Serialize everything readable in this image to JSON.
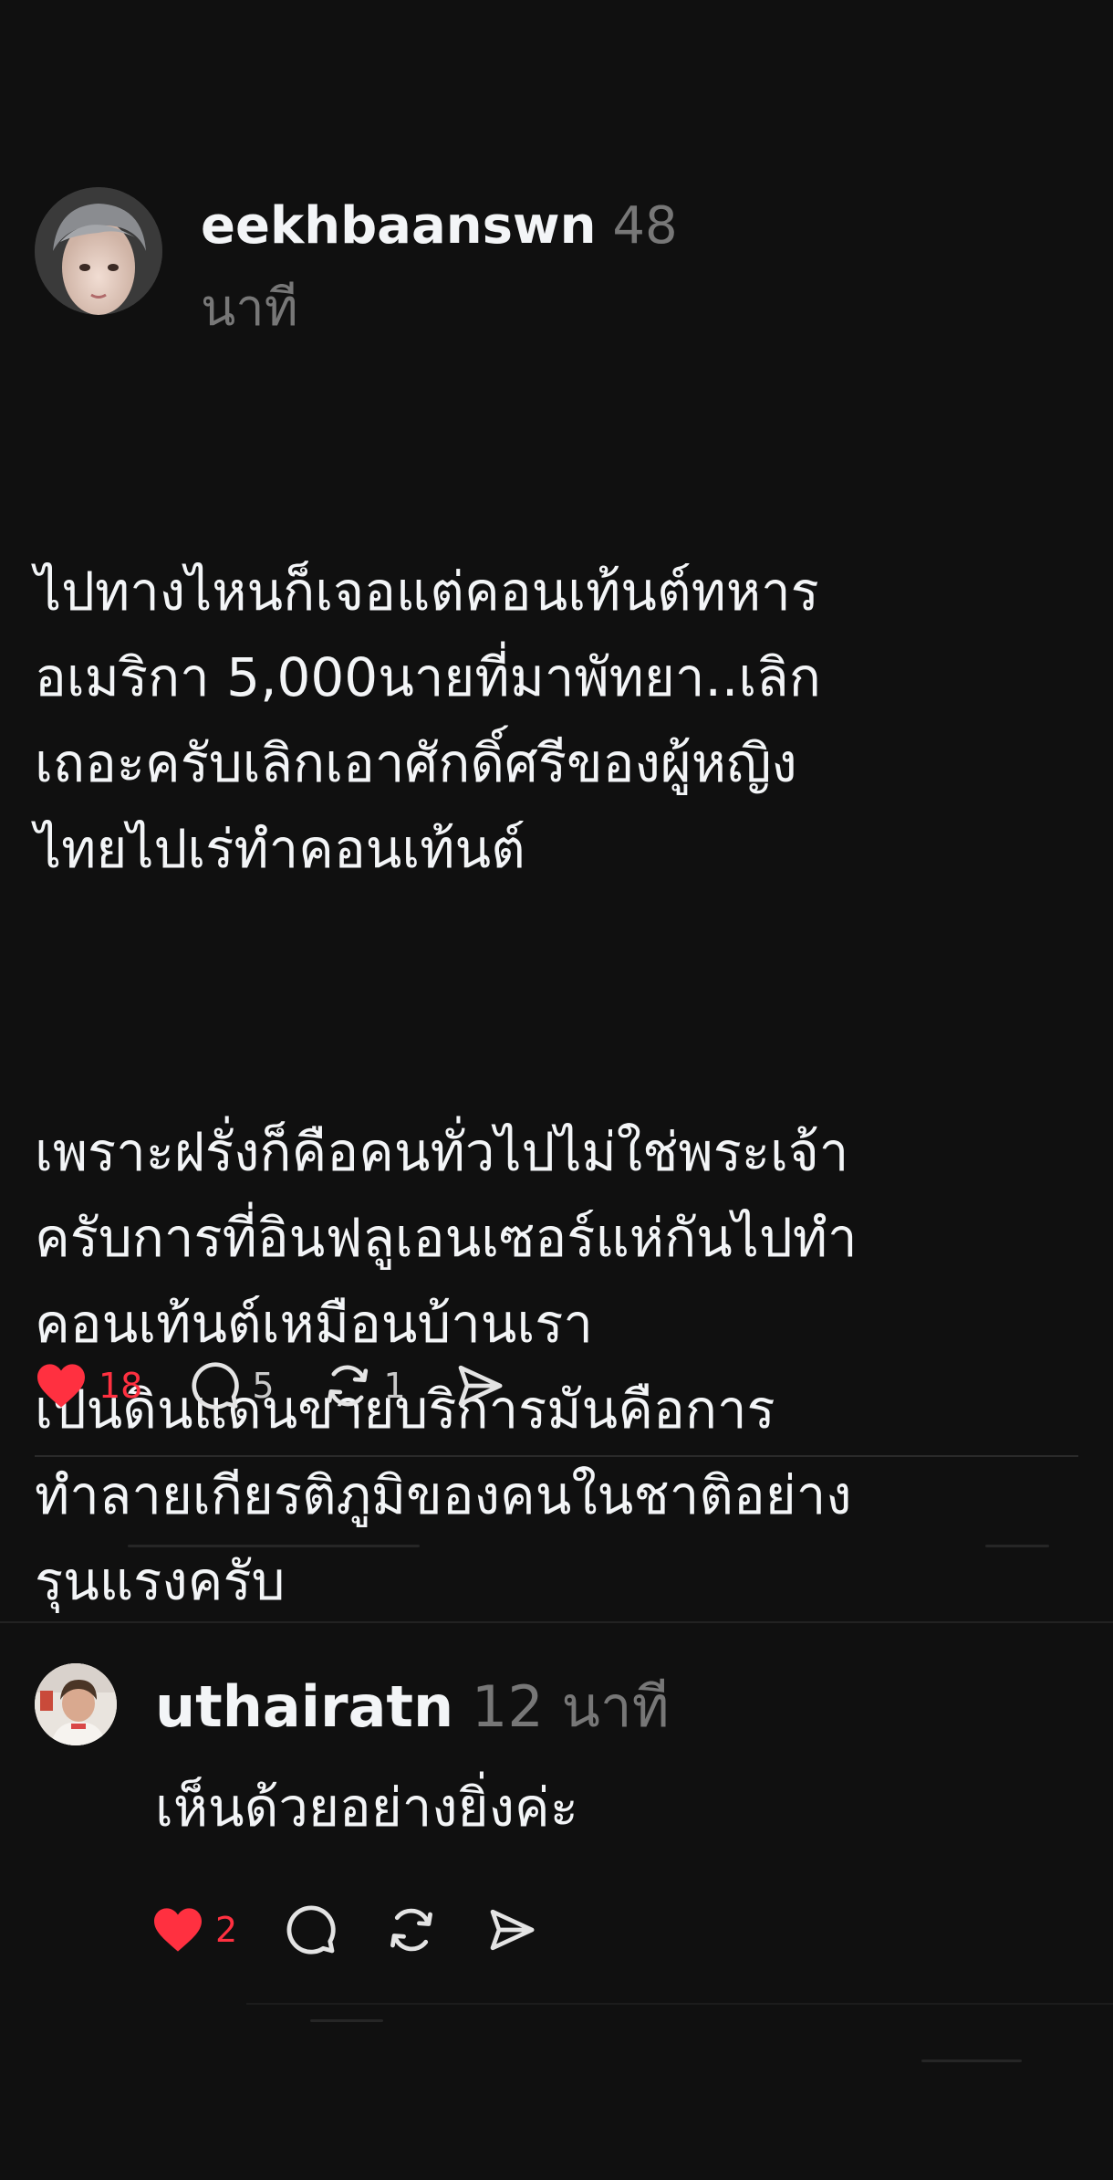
{
  "post": {
    "username": "eekhbaanswn",
    "time": "48 นาที",
    "paragraphs": [
      "ไปทางไหนก็เจอแต่คอนเท้นต์ทหาร\nอเมริกา 5,000นายที่มาพัทยา..เลิก\nเถอะครับเลิกเอาศักดิ์ศรีของผู้หญิง\nไทยไปเร่ทำคอนเท้นต์",
      "เพราะฝรั่งก็คือคนทั่วไปไม่ใช่พระเจ้า\nครับการที่อินฟลูเอนเซอร์แห่กันไปทำ\nคอนเท้นต์เหมือนบ้านเรา\nเป็นดินแดนขายบริการมันคือการ\nทำลายเกียรติภูมิของคนในชาติอย่าง\nรุนแรงครับ"
    ],
    "likes": "18",
    "comments": "5",
    "reposts": "1"
  },
  "reply": {
    "username": "uthairatn",
    "time": "12 นาที",
    "text": "เห็นด้วยอย่างยิ่งค่ะ",
    "likes": "2"
  },
  "colors": {
    "background": "#101010",
    "text": "#f3f5f7",
    "muted": "#777777",
    "like": "#ff3040"
  },
  "icons": [
    "heart-icon",
    "comment-icon",
    "repost-icon",
    "share-icon"
  ]
}
